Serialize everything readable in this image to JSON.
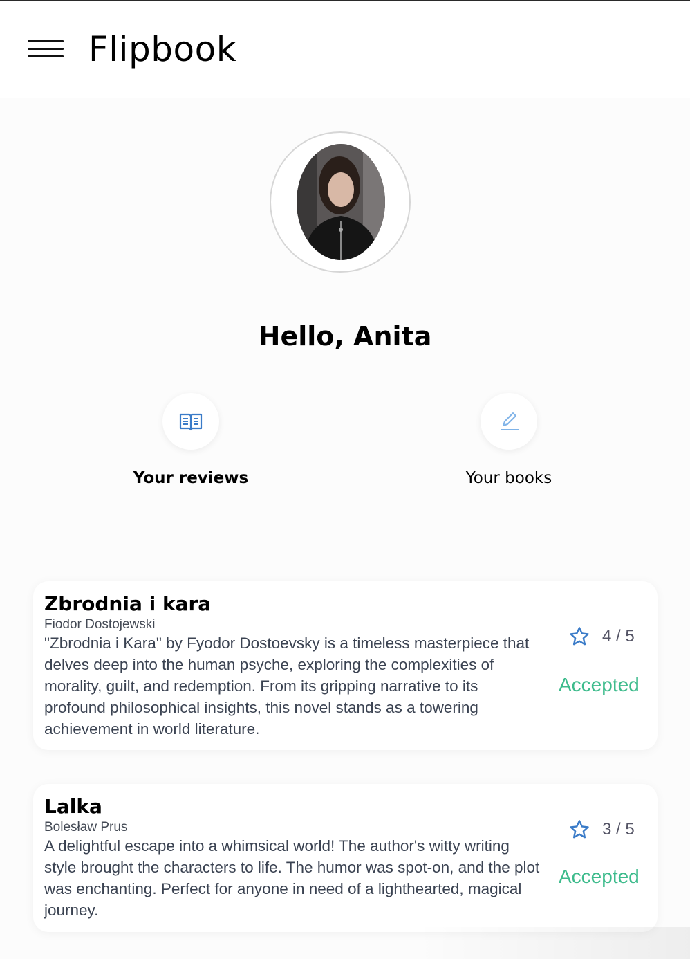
{
  "header": {
    "title": "Flipbook",
    "menu_icon": "hamburger-menu-icon"
  },
  "profile": {
    "greeting": "Hello, Anita",
    "avatar_alt": "user-avatar"
  },
  "actions": [
    {
      "label": "Your reviews",
      "icon": "open-book-icon",
      "active": true
    },
    {
      "label": "Your books",
      "icon": "pencil-icon",
      "active": false
    }
  ],
  "reviews": [
    {
      "title": "Zbrodnia i kara",
      "author": "Fiodor Dostojewski",
      "body": "\"Zbrodnia i Kara\" by Fyodor Dostoevsky is a timeless masterpiece that delves deep into the human psyche, exploring the complexities of morality, guilt, and redemption. From its gripping narrative to its profound philosophical insights, this novel stands as a towering achievement in world literature.",
      "rating": "4 / 5",
      "status": "Accepted"
    },
    {
      "title": "Lalka",
      "author": "Bolesław Prus",
      "body": "A delightful escape into a whimsical world! The author's witty writing style brought the characters to life. The humor was spot-on, and the plot was enchanting. Perfect for anyone in need of a lighthearted, magical journey.",
      "rating": "3 / 5",
      "status": "Accepted"
    }
  ],
  "colors": {
    "accent_blue": "#3a7bc8",
    "status_green": "#3dbb8c",
    "pencil_blue": "#7fb3e8"
  }
}
